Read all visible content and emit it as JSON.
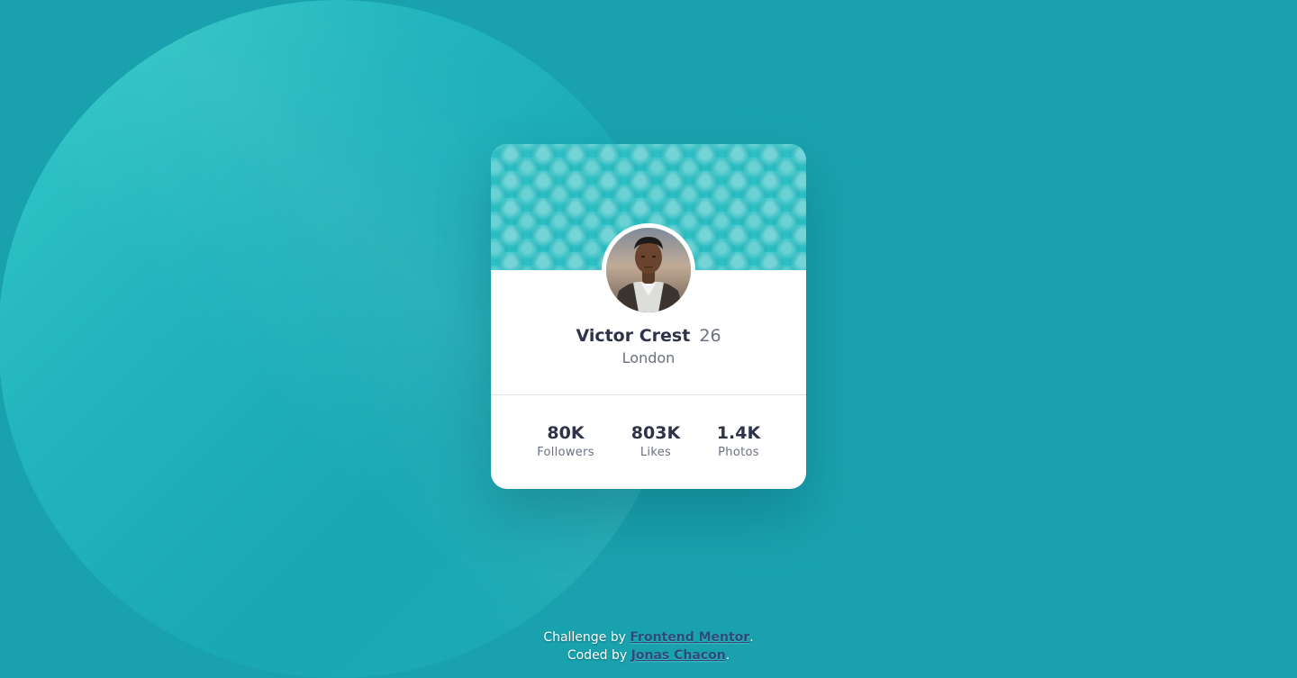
{
  "profile": {
    "name": "Victor Crest",
    "age": "26",
    "city": "London"
  },
  "stats": [
    {
      "value": "80K",
      "label": "Followers"
    },
    {
      "value": "803K",
      "label": "Likes"
    },
    {
      "value": "1.4K",
      "label": "Photos"
    }
  ],
  "attribution": {
    "challenge_prefix": "Challenge by ",
    "challenge_link": "Frontend Mentor",
    "challenge_suffix": ".",
    "coded_prefix": "Coded by ",
    "coded_link": "Jonas Chacon",
    "coded_suffix": "."
  },
  "colors": {
    "background": "#19a2ae",
    "card": "#ffffff",
    "header_pattern": "#30c6ca",
    "text_dark": "#2e3349",
    "text_muted": "#6b7082",
    "link": "#2c4a7a"
  },
  "icons": {
    "avatar": "avatar-photo"
  }
}
